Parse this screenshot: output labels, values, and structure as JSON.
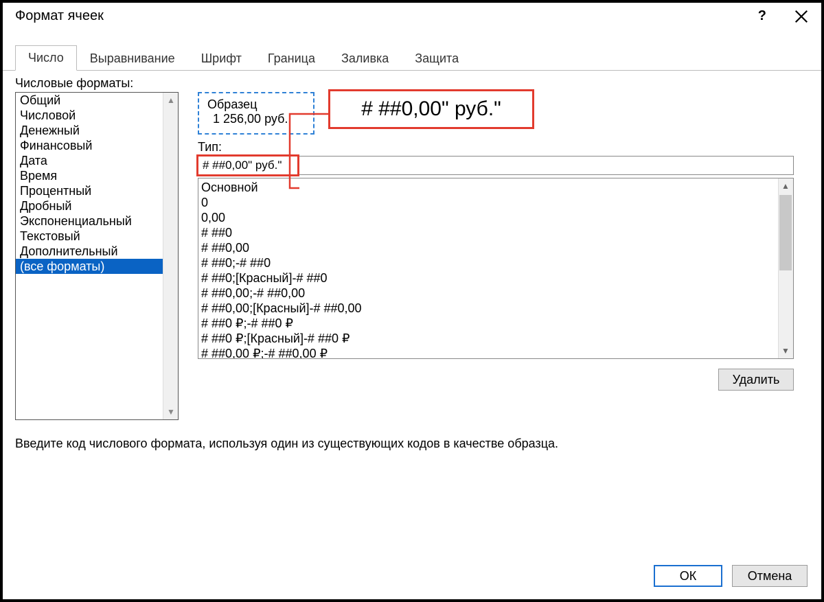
{
  "title": "Формат ячеек",
  "help": "?",
  "tabs": [
    "Число",
    "Выравнивание",
    "Шрифт",
    "Граница",
    "Заливка",
    "Защита"
  ],
  "active_tab_index": 0,
  "formats_label": "Числовые форматы:",
  "format_categories": [
    "Общий",
    "Числовой",
    "Денежный",
    "Финансовый",
    "Дата",
    "Время",
    "Процентный",
    "Дробный",
    "Экспоненциальный",
    "Текстовый",
    "Дополнительный",
    "(все форматы)"
  ],
  "selected_category_index": 11,
  "sample": {
    "label": "Образец",
    "value": "1 256,00 руб."
  },
  "callout_text": "# ##0,00\" руб.\"",
  "type_label": "Тип:",
  "type_value": "# ##0,00\" руб.\"",
  "type_options": [
    "Основной",
    "0",
    "0,00",
    "# ##0",
    "# ##0,00",
    "# ##0;-# ##0",
    "# ##0;[Красный]-# ##0",
    "# ##0,00;-# ##0,00",
    "# ##0,00;[Красный]-# ##0,00",
    "# ##0 ₽;-# ##0 ₽",
    "# ##0 ₽;[Красный]-# ##0 ₽",
    "# ##0,00 ₽;-# ##0,00 ₽"
  ],
  "delete_label": "Удалить",
  "hint": "Введите код числового формата, используя один из существующих кодов в качестве образца.",
  "ok_label": "ОК",
  "cancel_label": "Отмена"
}
